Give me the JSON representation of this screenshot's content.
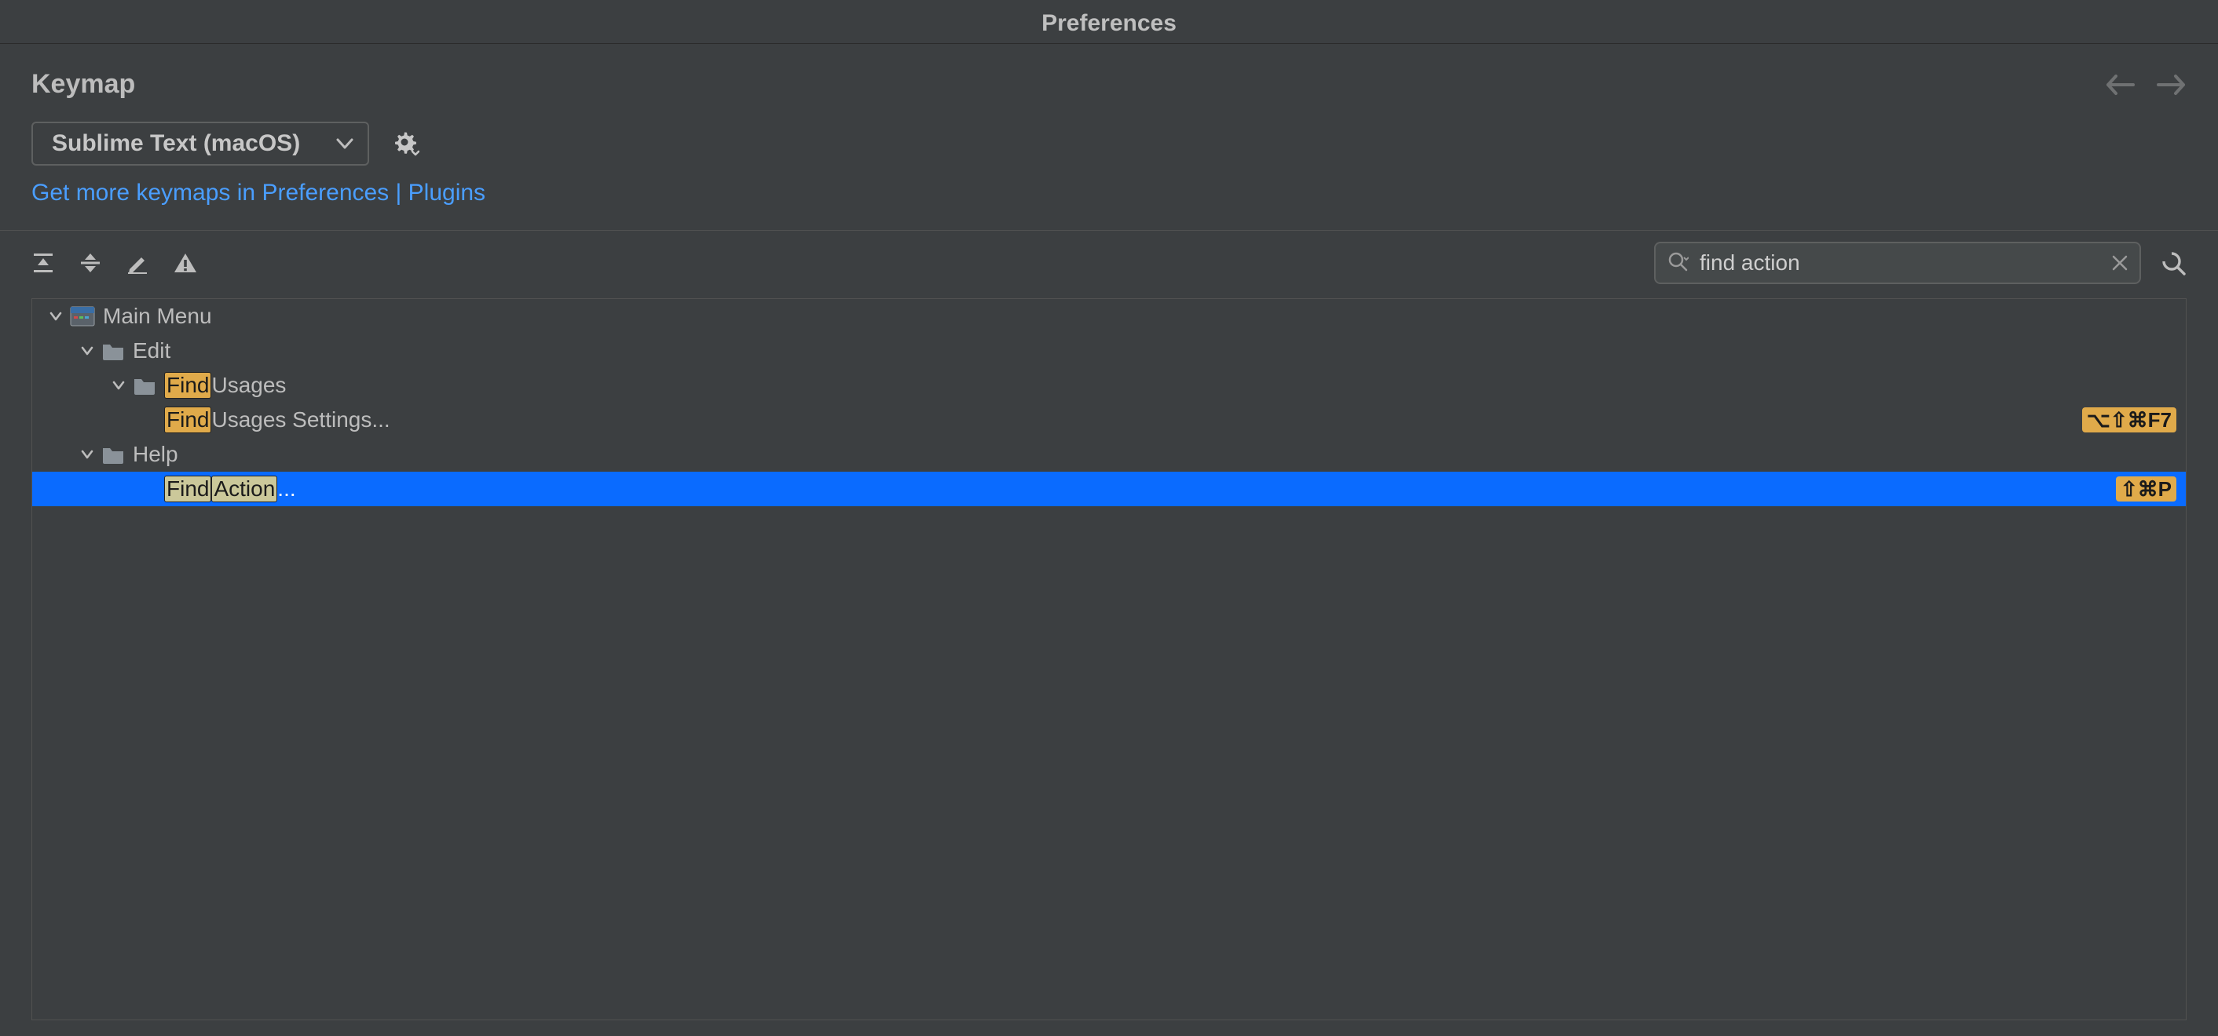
{
  "window": {
    "title": "Preferences"
  },
  "section": {
    "heading": "Keymap"
  },
  "keymap_select": {
    "value": "Sublime Text (macOS)"
  },
  "link": {
    "text": "Get more keymaps in Preferences | Plugins"
  },
  "search": {
    "value": "find action"
  },
  "tree": {
    "rows": [
      {
        "indent": 0,
        "expandable": true,
        "icon": "menu",
        "parts": [
          {
            "t": "Main Menu"
          }
        ],
        "shortcut": "",
        "selected": false
      },
      {
        "indent": 1,
        "expandable": true,
        "icon": "folder",
        "parts": [
          {
            "t": "Edit"
          }
        ],
        "shortcut": "",
        "selected": false
      },
      {
        "indent": 2,
        "expandable": true,
        "icon": "folder",
        "parts": [
          {
            "t": "Find",
            "hl": true
          },
          {
            "t": " Usages"
          }
        ],
        "shortcut": "",
        "selected": false
      },
      {
        "indent": 3,
        "expandable": false,
        "icon": "",
        "parts": [
          {
            "t": "Find",
            "hl": true
          },
          {
            "t": " Usages Settings..."
          }
        ],
        "shortcut": "⌥⇧⌘F7",
        "selected": false
      },
      {
        "indent": 1,
        "expandable": true,
        "icon": "folder",
        "parts": [
          {
            "t": "Help"
          }
        ],
        "shortcut": "",
        "selected": false
      },
      {
        "indent": 3,
        "expandable": false,
        "icon": "",
        "parts": [
          {
            "t": "Find",
            "hl": true
          },
          {
            "t": " "
          },
          {
            "t": "Action",
            "hl": true
          },
          {
            "t": "..."
          }
        ],
        "shortcut": "⇧⌘P",
        "selected": true
      }
    ]
  }
}
